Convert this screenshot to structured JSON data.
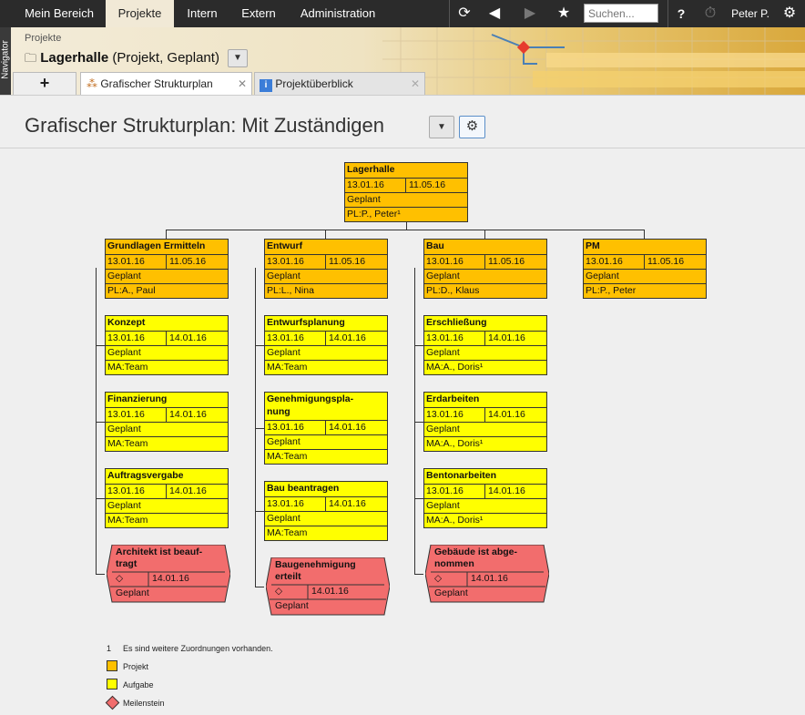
{
  "topbar": {
    "nav": [
      "Mein Bereich",
      "Projekte",
      "Intern",
      "Extern",
      "Administration"
    ],
    "search_placeholder": "Suchen...",
    "help": "?",
    "user": "Peter P."
  },
  "header": {
    "navigator_label": "Navigator",
    "breadcrumb": "Projekte",
    "project_name": "Lagerhalle",
    "project_status": "(Projekt, Geplant)",
    "tabs": [
      {
        "label": "+"
      },
      {
        "label": "Grafischer Strukturplan"
      },
      {
        "label": "Projektüberblick"
      }
    ]
  },
  "page": {
    "title": "Grafischer Strukturplan: Mit Zuständigen"
  },
  "chart": {
    "root": {
      "name": "Lagerhalle",
      "start": "13.01.16",
      "end": "11.05.16",
      "status": "Geplant",
      "person": "PL:P., Peter¹"
    },
    "columns": [
      {
        "head": {
          "name": "Grundlagen Ermitteln",
          "start": "13.01.16",
          "end": "11.05.16",
          "status": "Geplant",
          "person": "PL:A., Paul"
        },
        "tasks": [
          {
            "name": "Konzept",
            "start": "13.01.16",
            "end": "14.01.16",
            "status": "Geplant",
            "person": "MA:Team"
          },
          {
            "name": "Finanzierung",
            "start": "13.01.16",
            "end": "14.01.16",
            "status": "Geplant",
            "person": "MA:Team"
          },
          {
            "name": "Auftragsvergabe",
            "start": "13.01.16",
            "end": "14.01.16",
            "status": "Geplant",
            "person": "MA:Team"
          }
        ],
        "milestone": {
          "line1": "Architekt ist beauf-",
          "line2": "tragt",
          "symbol": "◇",
          "date": "14.01.16",
          "status": "Geplant"
        }
      },
      {
        "head": {
          "name": "Entwurf",
          "start": "13.01.16",
          "end": "11.05.16",
          "status": "Geplant",
          "person": "PL:L., Nina"
        },
        "tasks": [
          {
            "name": "Entwurfsplanung",
            "start": "13.01.16",
            "end": "14.01.16",
            "status": "Geplant",
            "person": "MA:Team"
          },
          {
            "name": "Genehmigungspla-",
            "name2": "nung",
            "start": "13.01.16",
            "end": "14.01.16",
            "status": "Geplant",
            "person": "MA:Team"
          },
          {
            "name": "Bau beantragen",
            "start": "13.01.16",
            "end": "14.01.16",
            "status": "Geplant",
            "person": "MA:Team"
          }
        ],
        "milestone": {
          "line1": "Baugenehmigung",
          "line2": "erteilt",
          "symbol": "◇",
          "date": "14.01.16",
          "status": "Geplant"
        }
      },
      {
        "head": {
          "name": "Bau",
          "start": "13.01.16",
          "end": "11.05.16",
          "status": "Geplant",
          "person": "PL:D., Klaus"
        },
        "tasks": [
          {
            "name": "Erschließung",
            "start": "13.01.16",
            "end": "14.01.16",
            "status": "Geplant",
            "person": "MA:A., Doris¹"
          },
          {
            "name": "Erdarbeiten",
            "start": "13.01.16",
            "end": "14.01.16",
            "status": "Geplant",
            "person": "MA:A., Doris¹"
          },
          {
            "name": "Bentonarbeiten",
            "start": "13.01.16",
            "end": "14.01.16",
            "status": "Geplant",
            "person": "MA:A., Doris¹"
          }
        ],
        "milestone": {
          "line1": "Gebäude ist abge-",
          "line2": "nommen",
          "symbol": "◇",
          "date": "14.01.16",
          "status": "Geplant"
        }
      },
      {
        "head": {
          "name": "PM",
          "start": "13.01.16",
          "end": "11.05.16",
          "status": "Geplant",
          "person": "PL:P., Peter"
        }
      }
    ]
  },
  "legend": {
    "footnote_num": "1",
    "footnote": "Es sind weitere Zuordnungen vorhanden.",
    "project": "Projekt",
    "task": "Aufgabe",
    "milestone": "Meilenstein"
  },
  "colors": {
    "project": "#ffc000",
    "task": "#ffff00",
    "milestone": "#f26d6d"
  }
}
